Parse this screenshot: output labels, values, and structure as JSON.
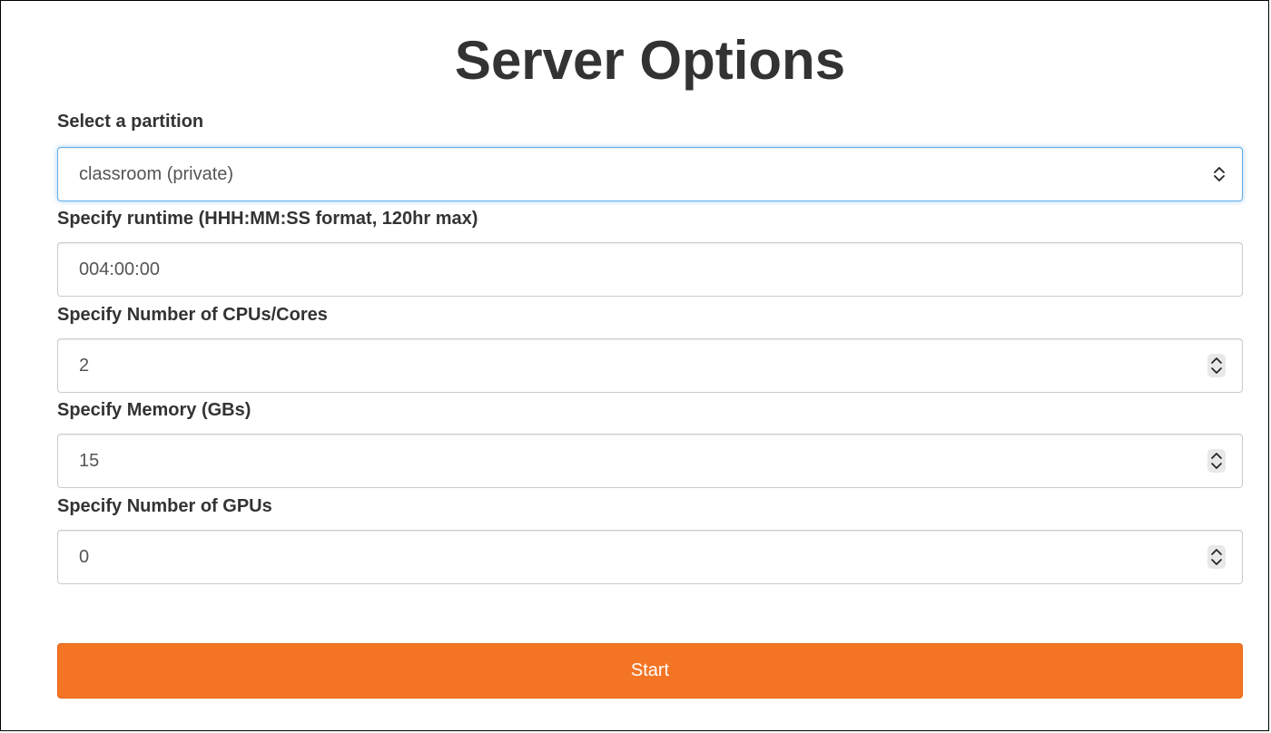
{
  "title": "Server Options",
  "partition": {
    "label": "Select a partition",
    "value": "classroom (private)"
  },
  "runtime": {
    "label": "Specify runtime (HHH:MM:SS format, 120hr max)",
    "value": "004:00:00"
  },
  "cpus": {
    "label": "Specify Number of CPUs/Cores",
    "value": "2"
  },
  "memory": {
    "label": "Specify Memory (GBs)",
    "value": "15"
  },
  "gpus": {
    "label": "Specify Number of GPUs",
    "value": "0"
  },
  "start_button": {
    "label": "Start"
  },
  "colors": {
    "accent": "#f37524",
    "focus_border": "#66afe9",
    "text": "#333333"
  }
}
